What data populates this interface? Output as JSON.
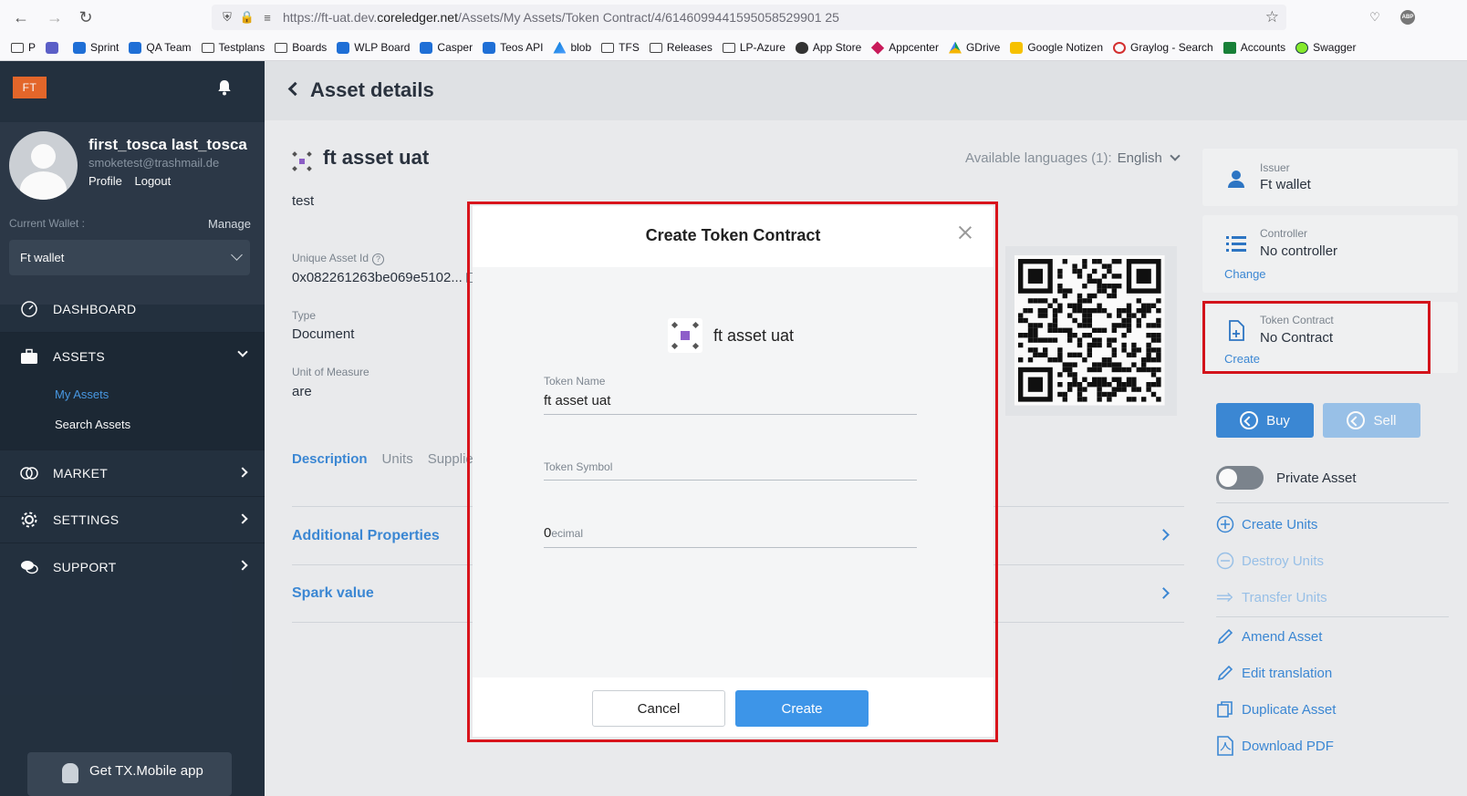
{
  "browser": {
    "url_prefix": "https://ft-uat.dev.",
    "url_host": "coreledger.net",
    "url_path": "/Assets/My Assets/Token Contract/4/6146099441595058529901 25",
    "bookmarks": [
      "P",
      "",
      "Sprint",
      "QA Team",
      "Testplans",
      "Boards",
      "WLP Board",
      "Casper",
      "Teos API",
      "blob",
      "TFS",
      "Releases",
      "LP-Azure",
      "App Store",
      "Appcenter",
      "GDrive",
      "Google Notizen",
      "Graylog - Search",
      "Accounts",
      "Swagger"
    ]
  },
  "sidebar": {
    "logo": "FT",
    "user_name": "first_tosca last_tosca",
    "user_email": "smoketest@trashmail.de",
    "profile_link": "Profile",
    "logout_link": "Logout",
    "current_wallet_label": "Current Wallet :",
    "manage_label": "Manage",
    "wallet_value": "Ft wallet",
    "menu": {
      "dashboard": "DASHBOARD",
      "assets": "ASSETS",
      "my_assets": "My Assets",
      "search_assets": "Search Assets",
      "market": "MARKET",
      "settings": "SETTINGS",
      "support": "SUPPORT"
    },
    "mobile_app": "Get TX.Mobile app"
  },
  "page": {
    "title": "Asset details",
    "asset_name": "ft asset uat",
    "available_languages": "Available languages (1):",
    "language": "English",
    "description": "test",
    "unique_id_label": "Unique Asset Id",
    "unique_id_value": "0x082261263be069e5102...",
    "type_label": "Type",
    "type_value": "Document",
    "uom_label": "Unit of Measure",
    "uom_value": "are",
    "tabs": [
      "Description",
      "Units",
      "Supplie"
    ],
    "section_additional": "Additional Properties",
    "section_spark": "Spark value"
  },
  "right_panel": {
    "issuer_label": "Issuer",
    "issuer_value": "Ft wallet",
    "controller_label": "Controller",
    "controller_value": "No controller",
    "controller_link": "Change",
    "token_label": "Token Contract",
    "token_value": "No Contract",
    "token_link": "Create",
    "buy": "Buy",
    "sell": "Sell",
    "private_asset": "Private Asset",
    "actions": {
      "create_units": "Create Units",
      "destroy_units": "Destroy Units",
      "transfer_units": "Transfer Units",
      "amend_asset": "Amend Asset",
      "edit_translation": "Edit translation",
      "duplicate_asset": "Duplicate Asset",
      "download_pdf": "Download PDF"
    },
    "colors": {
      "primary": "#3d8ad8",
      "buy": "#3d8ad8",
      "sell": "#9cc4ec"
    }
  },
  "modal": {
    "title": "Create Token Contract",
    "asset_name": "ft asset uat",
    "token_name_label": "Token Name",
    "token_name_value": "ft asset uat",
    "token_symbol_placeholder": "Token Symbol",
    "decimal_value": "0",
    "decimal_placeholder": "ecimal",
    "cancel": "Cancel",
    "create": "Create",
    "highlight_color": "#d8141c"
  }
}
